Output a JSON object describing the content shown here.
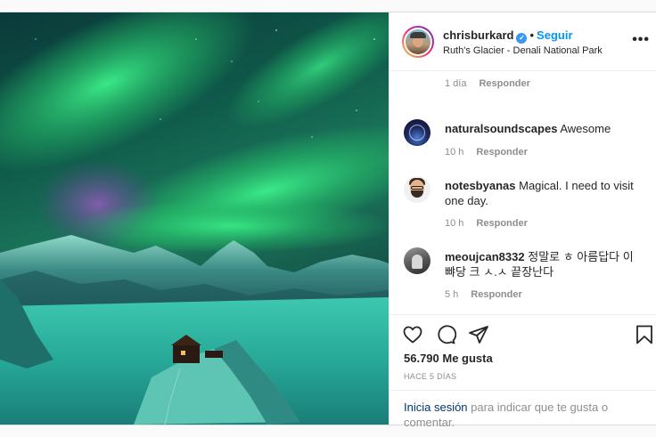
{
  "post": {
    "username": "chrisburkard",
    "verified_mark": "✓",
    "separator": "•",
    "follow_label": "Seguir",
    "location": "Ruth's Glacier - Denali National Park",
    "more_label": "•••"
  },
  "first_meta": {
    "time": "1 día",
    "reply": "Responder"
  },
  "comments": [
    {
      "username": "naturalsoundscapes",
      "text": "Awesome",
      "time": "10 h",
      "reply": "Responder"
    },
    {
      "username": "notesbyanas",
      "text": "Magical. I need to visit one day.",
      "time": "10 h",
      "reply": "Responder"
    },
    {
      "username": "meoujcan8332",
      "text": "정말로 ㅎ 아름답다 이 뺘당 크 ㅅ.ㅅ 끝장난다",
      "time": "5 h",
      "reply": "Responder"
    }
  ],
  "actions": {
    "icons": [
      "heart-icon",
      "comment-icon",
      "share-icon",
      "bookmark-icon"
    ],
    "likes": "56.790 Me gusta",
    "time_ago": "HACE 5 DÍAS"
  },
  "login_prompt": {
    "link": "Inicia sesión",
    "rest": " para indicar que te gusta o comentar."
  },
  "colors": {
    "accent": "#0095f6",
    "aurora": "#2bd870",
    "text": "#262626",
    "muted": "#8e8e8e"
  }
}
